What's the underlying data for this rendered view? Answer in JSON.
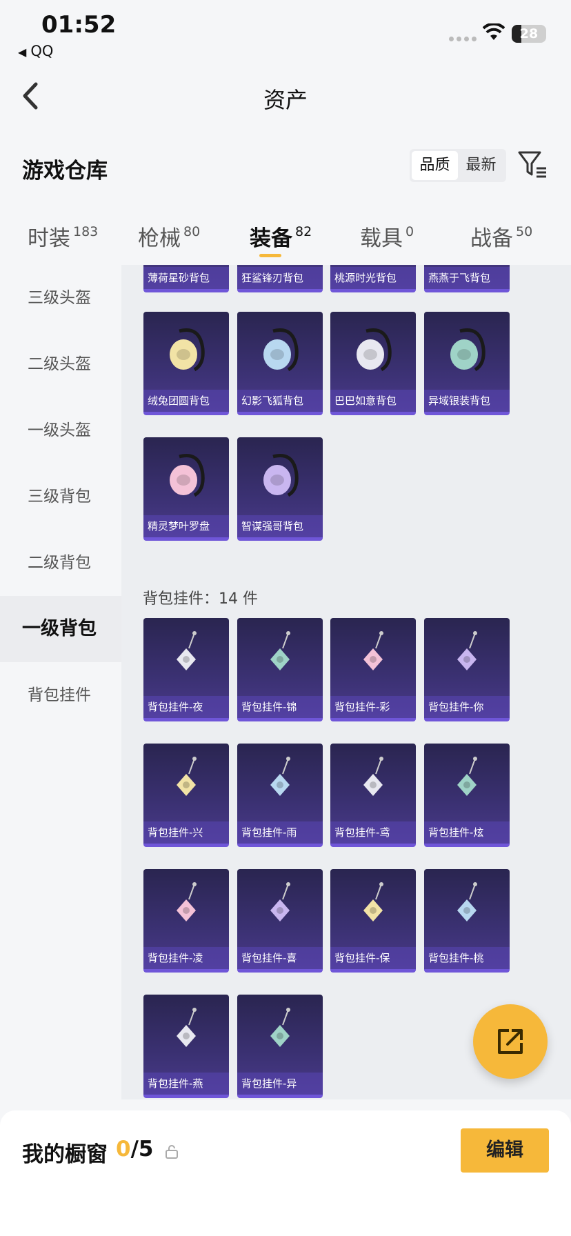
{
  "status": {
    "time": "01:52",
    "back_app": "QQ",
    "battery": "28",
    "battery_level": 0.28
  },
  "nav": {
    "title": "资产"
  },
  "warehouse": {
    "title": "游戏仓库",
    "sort_options": [
      "品质",
      "最新"
    ],
    "sort_active": "品质"
  },
  "tabs": [
    {
      "label": "时装",
      "count": "183"
    },
    {
      "label": "枪械",
      "count": "80"
    },
    {
      "label": "装备",
      "count": "82",
      "active": true
    },
    {
      "label": "载具",
      "count": "0"
    },
    {
      "label": "战备",
      "count": "50"
    }
  ],
  "sidebar": {
    "items": [
      "三级头盔",
      "二级头盔",
      "一级头盔",
      "三级背包",
      "二级背包",
      "一级背包",
      "背包挂件"
    ],
    "active": "一级背包"
  },
  "backpacks": [
    "薄荷星砂背包",
    "狂鲨锋刃背包",
    "桃源时光背包",
    "燕燕于飞背包",
    "绒兔团圆背包",
    "幻影飞狐背包",
    "巴巴如意背包",
    "异域银装背包",
    "精灵梦叶罗盘",
    "智谋强哥背包"
  ],
  "pendant_section": {
    "label": "背包挂件：14 件"
  },
  "pendants": [
    "背包挂件-夜",
    "背包挂件-锦",
    "背包挂件-彩",
    "背包挂件-你",
    "背包挂件-兴",
    "背包挂件-雨",
    "背包挂件-鸢",
    "背包挂件-炫",
    "背包挂件-凌",
    "背包挂件-喜",
    "背包挂件-保",
    "背包挂件-桃",
    "背包挂件-燕",
    "背包挂件-异"
  ],
  "bottom": {
    "label": "我的橱窗",
    "current": "0",
    "total": "/5",
    "edit": "编辑"
  },
  "colors": {
    "accent": "#f6b83a",
    "card_bg": "#3b3173",
    "card_border": "#6f56d8"
  }
}
